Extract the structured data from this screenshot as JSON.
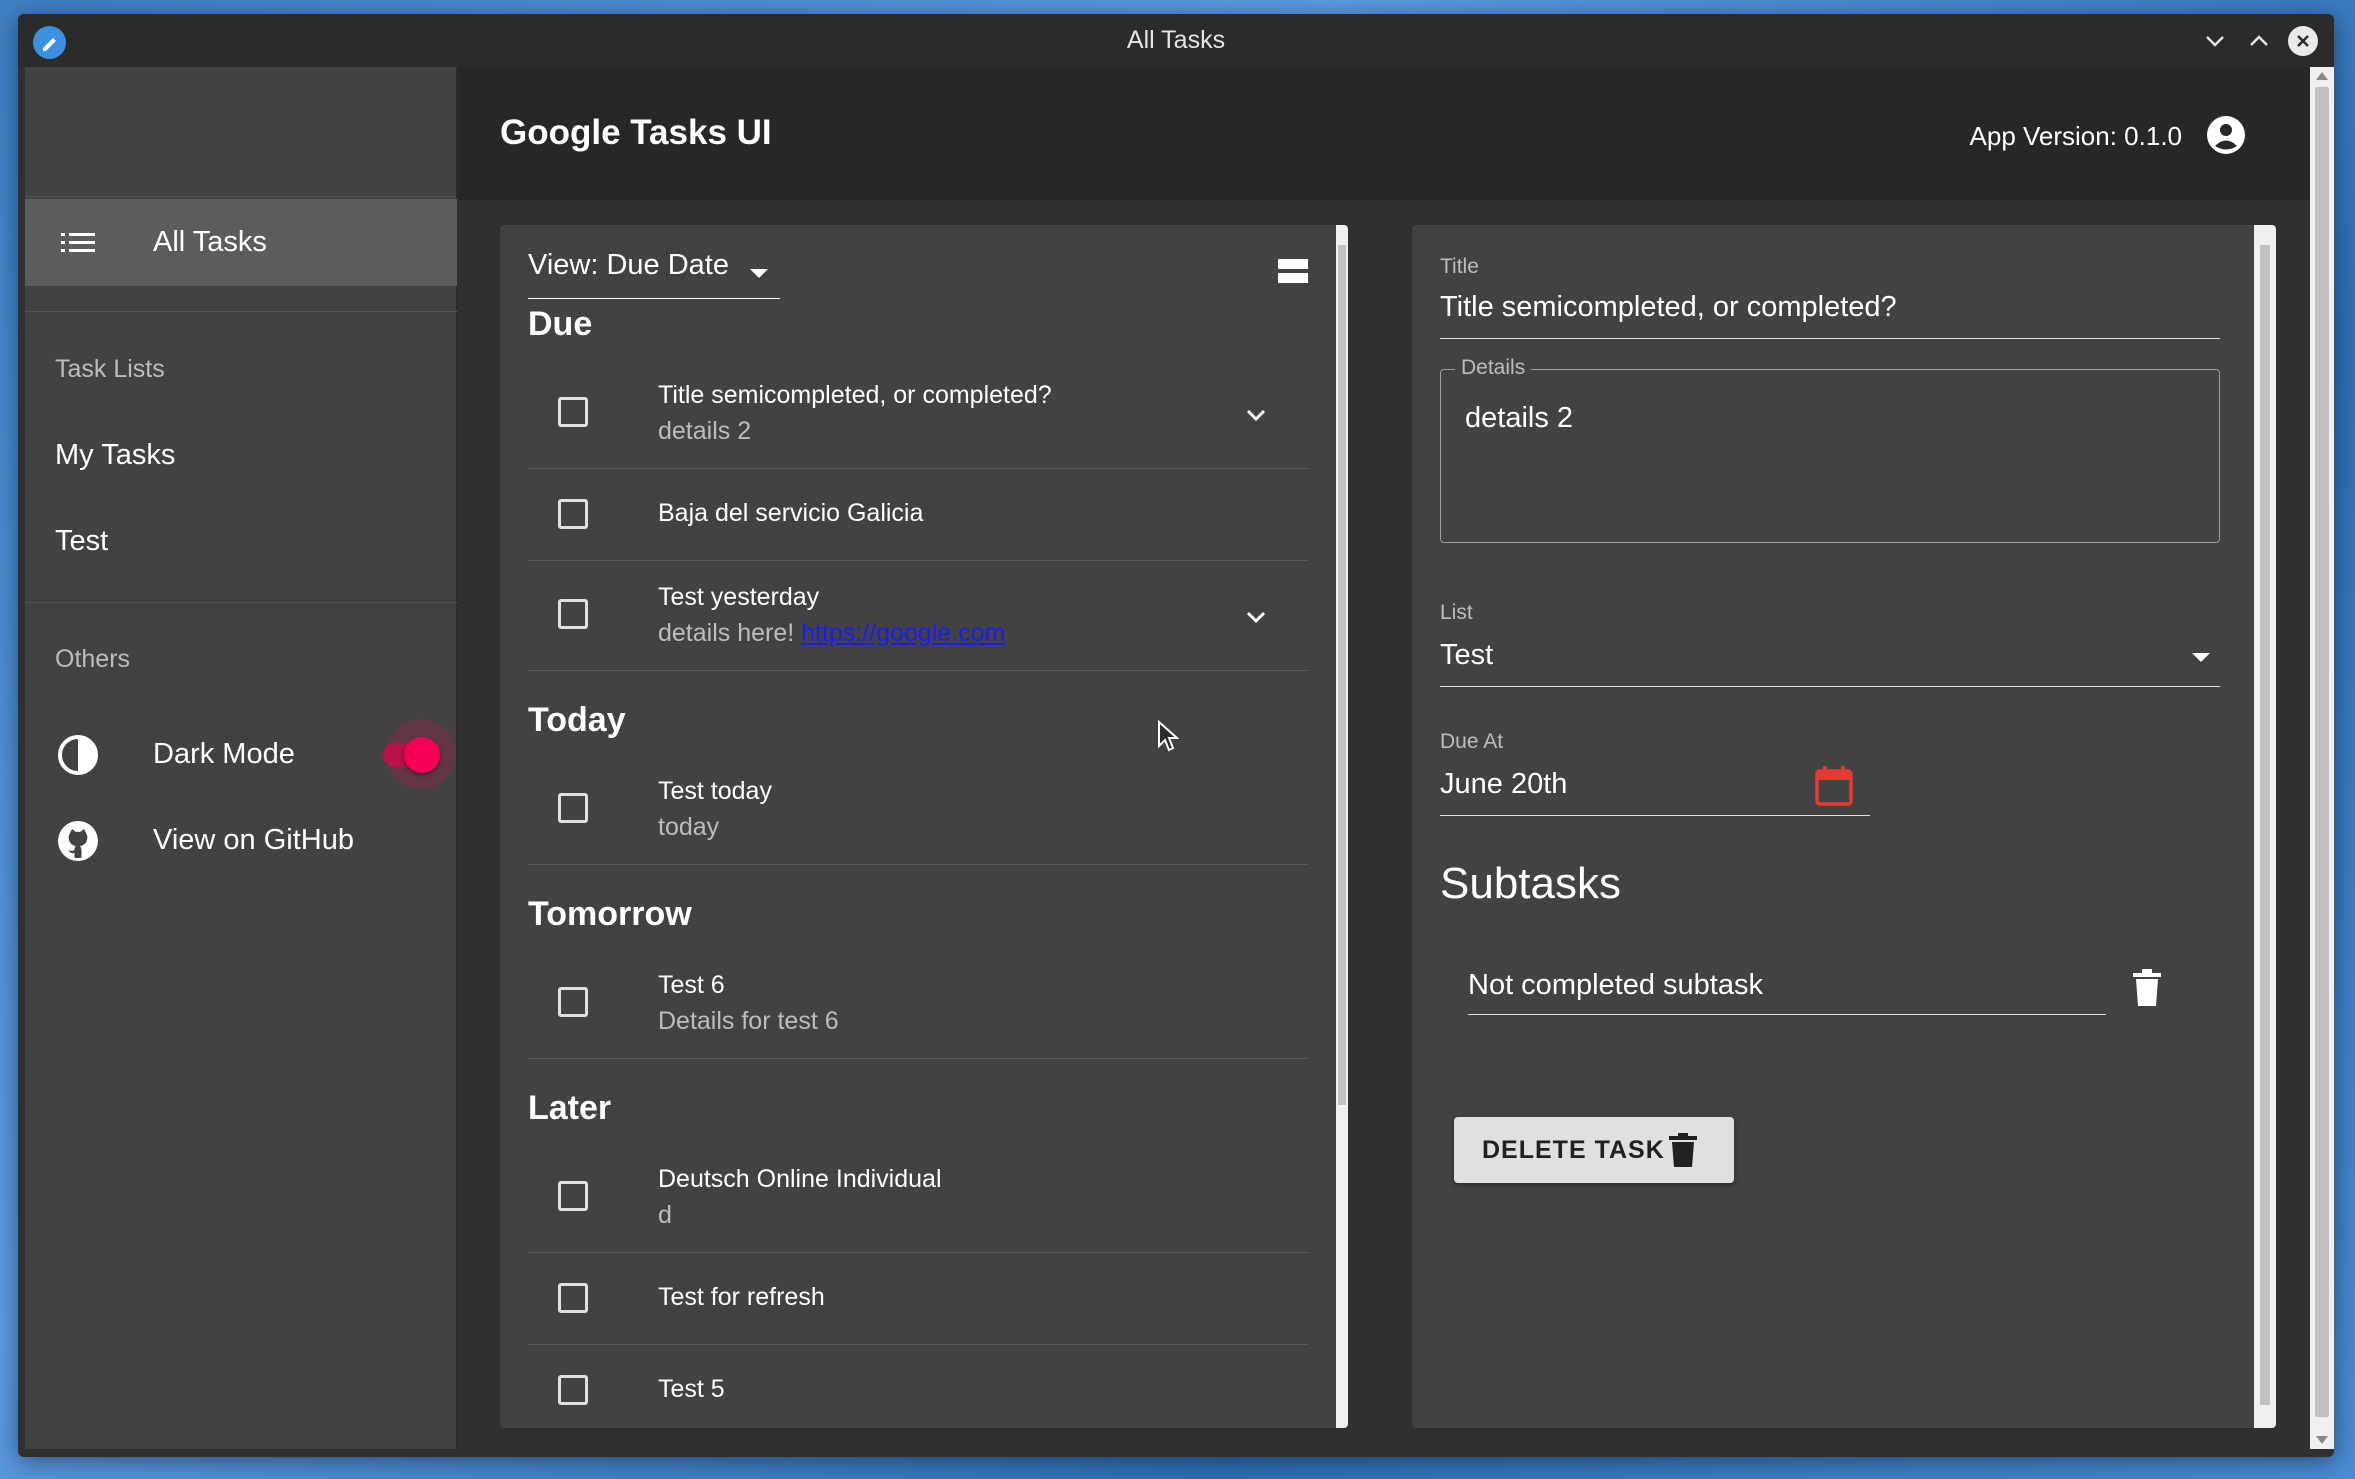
{
  "window": {
    "title": "All Tasks"
  },
  "sidebar": {
    "all_tasks_label": "All Tasks",
    "task_lists_header": "Task Lists",
    "lists": [
      "My Tasks",
      "Test"
    ],
    "others_header": "Others",
    "dark_mode_label": "Dark Mode",
    "dark_mode_on": true,
    "github_label": "View on GitHub"
  },
  "header": {
    "app_title": "Google Tasks UI",
    "version": "App Version: 0.1.0"
  },
  "task_list": {
    "view_label": "View: Due Date",
    "groups": {
      "due": "Due",
      "today": "Today",
      "tomorrow": "Tomorrow",
      "later": "Later"
    },
    "tasks": [
      {
        "title": "Title semicompleted, or completed?",
        "details": "details 2"
      },
      {
        "title": "Baja del servicio Galicia",
        "details": ""
      },
      {
        "title": "Test yesterday",
        "details": "details here!",
        "link": "https://google.com"
      },
      {
        "title": "Test today",
        "details": "today"
      },
      {
        "title": "Test 6",
        "details": "Details for test 6"
      },
      {
        "title": "Deutsch Online Individual",
        "details": "d"
      },
      {
        "title": "Test for refresh",
        "details": ""
      },
      {
        "title": "Test 5",
        "details": ""
      }
    ]
  },
  "detail": {
    "title_label": "Title",
    "title_value": "Title semicompleted, or completed?",
    "details_label": "Details",
    "details_value": "details 2",
    "list_label": "List",
    "list_value": "Test",
    "due_label": "Due At",
    "due_value": "June 20th",
    "subtasks_header": "Subtasks",
    "subtasks": [
      "Not completed subtask"
    ],
    "delete_label": "DELETE TASK"
  },
  "colors": {
    "accent": "#f50057",
    "calendar_icon": "#e53935",
    "link": "#1a1aff"
  }
}
